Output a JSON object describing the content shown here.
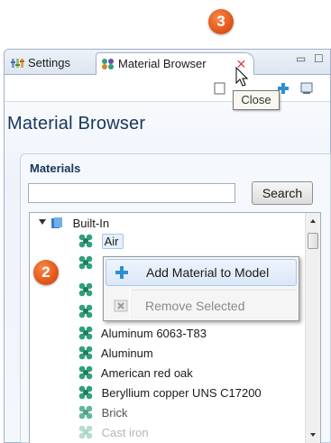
{
  "badges": {
    "step_3": "3",
    "step_2": "2"
  },
  "tabs": [
    {
      "label": "Settings",
      "icon": "settings-icon"
    },
    {
      "label": "Material Browser",
      "icon": "material-icon"
    }
  ],
  "tooltip": "Close",
  "panel_title": "Material Browser",
  "materials": {
    "section_title": "Materials",
    "search_value": "",
    "search_button": "Search",
    "tree": {
      "root": "Built-In",
      "items": [
        "Air",
        "Aluminum 6063-T83",
        "Aluminum",
        "American red oak",
        "Beryllium copper UNS C17200",
        "Brick",
        "Cast iron"
      ]
    }
  },
  "context_menu": {
    "items": [
      {
        "label": "Add Material to Model",
        "enabled": true,
        "icon": "plus-icon"
      },
      {
        "label": "Remove Selected",
        "enabled": false,
        "icon": "remove-icon"
      }
    ]
  },
  "colors": {
    "accent": "#e2571b",
    "title": "#17365d",
    "close": "#e04040",
    "material_icon": "#2fa07a"
  }
}
